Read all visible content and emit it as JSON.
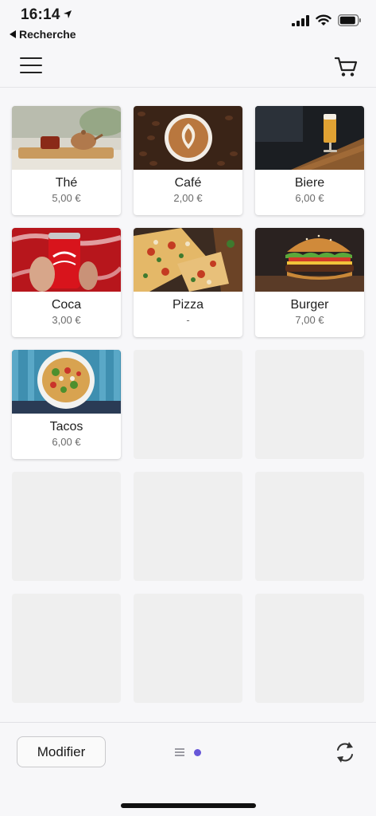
{
  "status_bar": {
    "time": "16:14",
    "back_app_label": "Recherche"
  },
  "app_bar": {
    "menu_icon": "hamburger-icon",
    "cart_icon": "cart-icon"
  },
  "products": [
    {
      "name": "Thé",
      "price": "5,00 €",
      "image": "tea"
    },
    {
      "name": "Café",
      "price": "2,00 €",
      "image": "coffee"
    },
    {
      "name": "Biere",
      "price": "6,00 €",
      "image": "beer"
    },
    {
      "name": "Coca",
      "price": "3,00 €",
      "image": "cola"
    },
    {
      "name": "Pizza",
      "price": "-",
      "image": "pizza"
    },
    {
      "name": "Burger",
      "price": "7,00 €",
      "image": "burger"
    },
    {
      "name": "Tacos",
      "price": "6,00 €",
      "image": "tacos"
    }
  ],
  "empty_slots": 8,
  "bottom_bar": {
    "modify_label": "Modifier",
    "pager_active_color": "#6757d8",
    "refresh_icon": "refresh-icon"
  }
}
